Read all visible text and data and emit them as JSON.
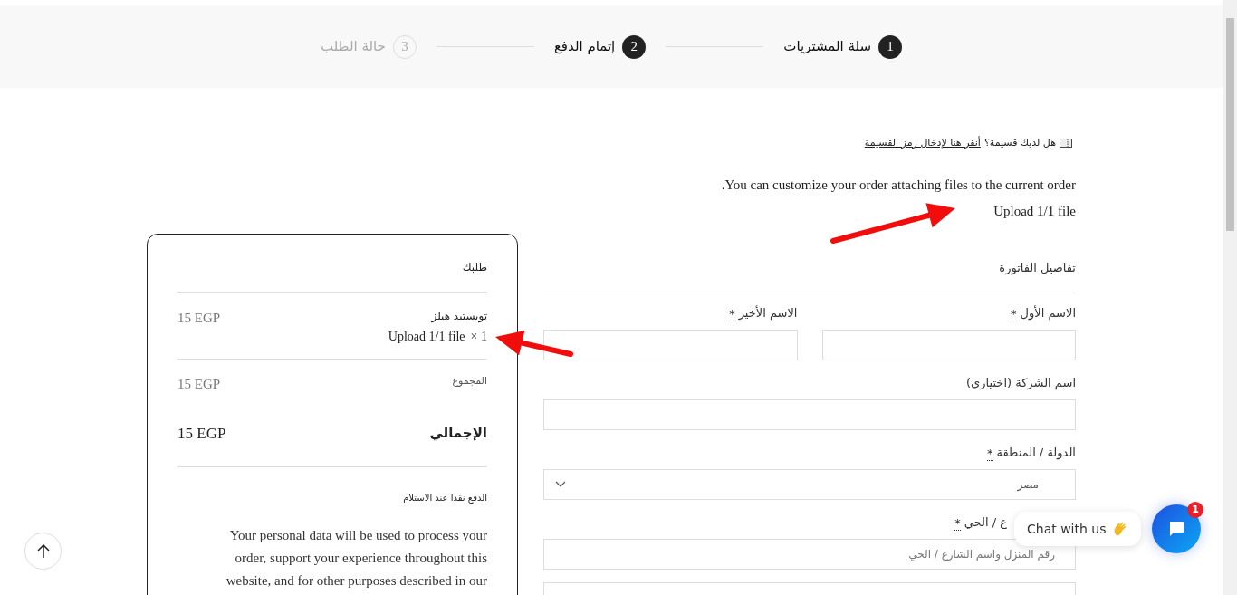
{
  "steps": [
    {
      "number": "1",
      "label": "سلة المشتريات",
      "active": true
    },
    {
      "number": "2",
      "label": "إتمام الدفع",
      "active": true
    },
    {
      "number": "3",
      "label": "حالة الطلب",
      "active": false
    }
  ],
  "coupon": {
    "question": "هل لديك قسيمة؟",
    "link": "أنقر هنا لإدخال رمز القسيمة"
  },
  "customize_note": "You can customize your order attaching files to the current order.",
  "upload_link": "Upload 1/1 file",
  "order": {
    "title": "طلبك",
    "items": [
      {
        "name": "تويستيد هيلز",
        "quantity": "× 1",
        "upload": "Upload 1/1 file",
        "price": "15 EGP"
      }
    ],
    "subtotal": {
      "label": "المجموع",
      "value": "15 EGP"
    },
    "total": {
      "label": "الإجمالي",
      "value": "15 EGP"
    },
    "payment": "الدفع نقدا عند الاستلام",
    "privacy": "Your personal data will be used to process your order, support your experience throughout this website, and for other purposes described in our"
  },
  "billing": {
    "title": "تفاصيل الفاتورة",
    "fields": [
      {
        "kind": "pair",
        "items": [
          {
            "label": "الاسم الأول",
            "required_mark": "*"
          },
          {
            "label": "الاسم الأخير",
            "required_mark": "*"
          }
        ]
      },
      {
        "kind": "text",
        "label": "اسم الشركة (اختياري)"
      },
      {
        "kind": "select",
        "label": "الدولة / المنطقة",
        "required_mark": "*",
        "value": "مصر"
      },
      {
        "kind": "text",
        "label": "ع / الحي",
        "required_mark": "*",
        "placeholder": "رقم المنزل واسم الشارع / الحي"
      },
      {
        "kind": "text"
      }
    ]
  },
  "chat": {
    "label": "Chat with us",
    "badge": "1"
  }
}
